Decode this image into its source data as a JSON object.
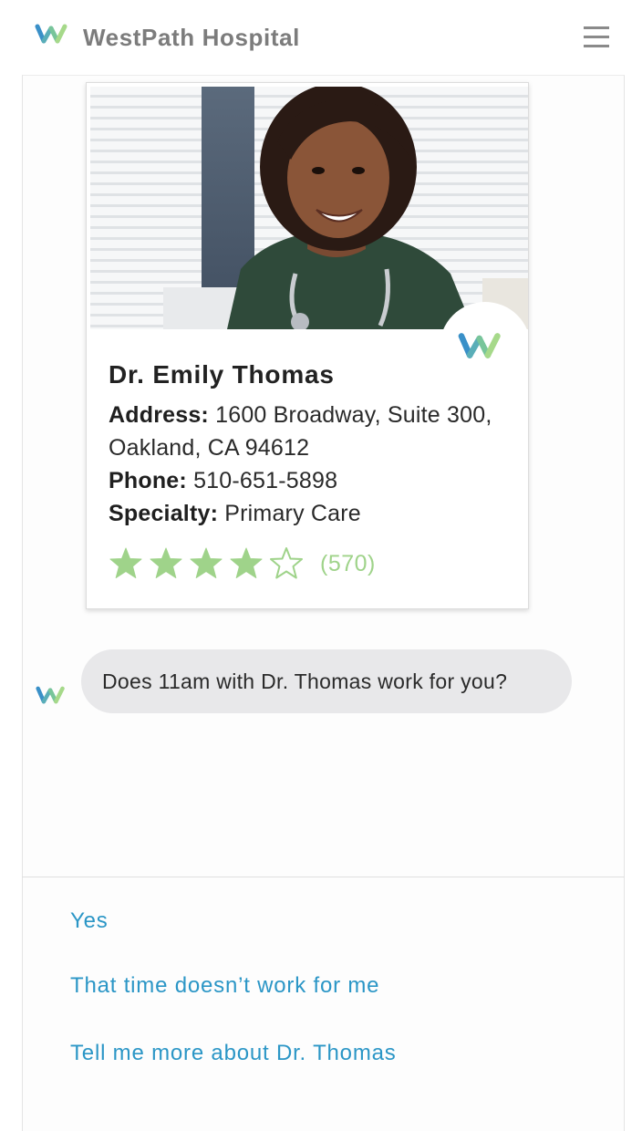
{
  "header": {
    "brand": "WestPath Hospital",
    "logo_icon": "westpath-w-logo-icon",
    "menu_icon": "hamburger-menu-icon"
  },
  "colors": {
    "brand_text": "#7c7c7c",
    "star_green": "#9fd38a",
    "link_blue": "#2b96c6",
    "bubble_bg": "#e8e8ea"
  },
  "doctor_card": {
    "name": "Dr. Emily Thomas",
    "address_label": "Address:",
    "address_value": "1600 Broadway, Suite 300, Oakland, CA 94612",
    "phone_label": "Phone:",
    "phone_value": "510-651-5898",
    "specialty_label": "Specialty:",
    "specialty_value": "Primary Care",
    "rating": {
      "stars_filled": 4,
      "stars_total": 5,
      "count": "(570)"
    }
  },
  "chat": {
    "bot_message": "Does 11am with Dr. Thomas work for you?"
  },
  "quick_replies": [
    "Yes",
    "That time doesn’t work for me",
    "Tell me more about Dr. Thomas"
  ]
}
